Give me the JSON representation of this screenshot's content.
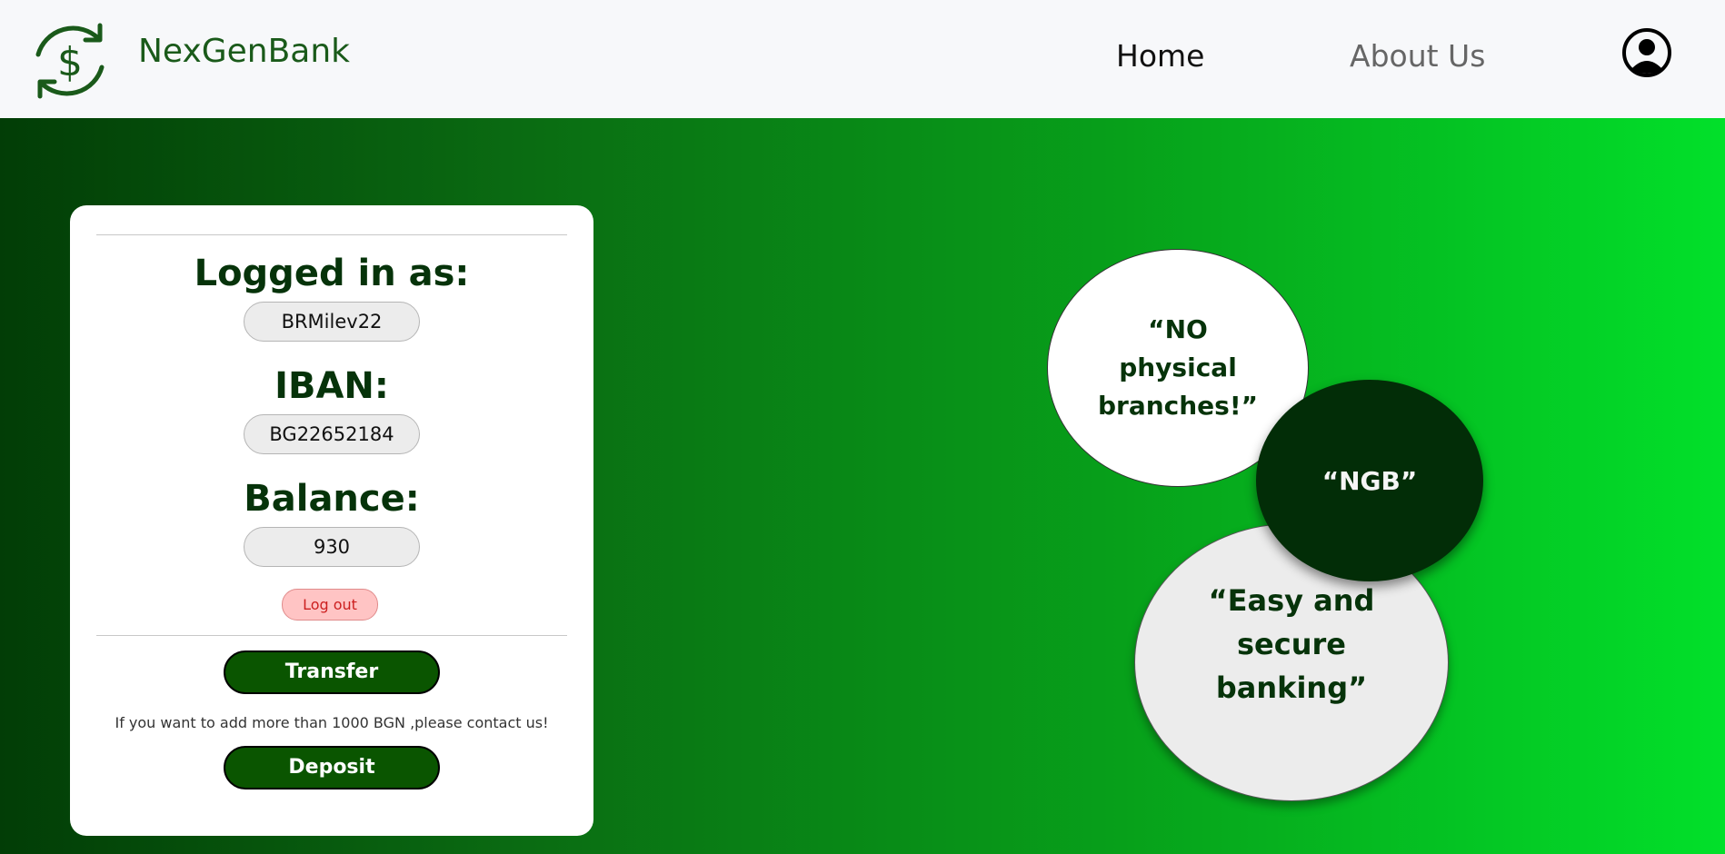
{
  "nav": {
    "brand": "NexGenBank",
    "links": [
      "Home",
      "About Us"
    ],
    "logo_icon": "dollar-cycle-icon",
    "profile_icon": "user-icon"
  },
  "account": {
    "logged_in_label": "Logged in as:",
    "username": "BRMilev22",
    "iban_label": "IBAN:",
    "iban": "BG22652184",
    "balance_label": "Balance:",
    "balance": "930",
    "logout_label": "Log out",
    "transfer_label": "Transfer",
    "deposit_note": "If you want to add more than 1000 BGN ,please contact us!",
    "deposit_label": "Deposit"
  },
  "bubbles": {
    "top": "“NO physical branches!”",
    "middle": "“NGB”",
    "bottom": "“Easy and secure banking”"
  },
  "colors": {
    "brand_green": "#1a5a1a",
    "dark_green": "#06330a",
    "button_green": "#0a5500",
    "logout_bg": "#ffc4c4",
    "logout_text": "#cc1f1f"
  }
}
